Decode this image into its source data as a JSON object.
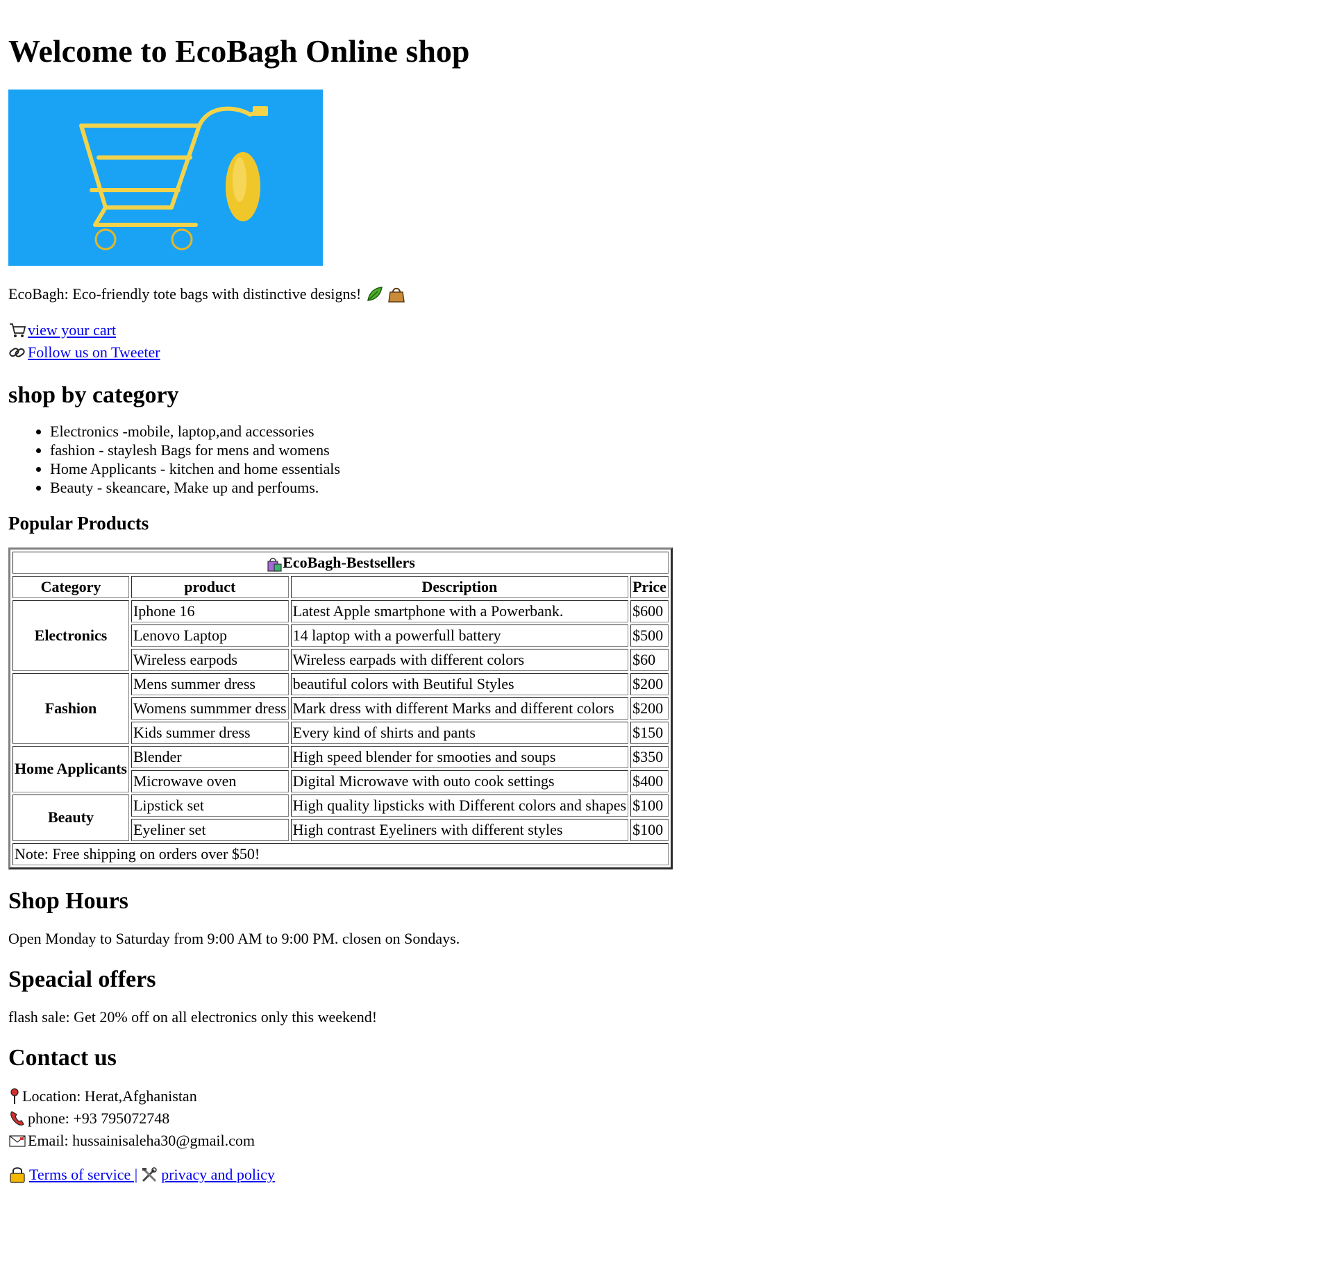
{
  "page": {
    "title": "Welcome to EcoBagh Online shop",
    "tagline": "EcoBagh: Eco-friendly tote bags with distinctive designs!"
  },
  "links": {
    "cart": " view your cart",
    "tweeter": "Follow us on Tweeter"
  },
  "categories": {
    "heading": "shop by category",
    "items": [
      "Electronics -mobile, laptop,and accessories",
      "fashion - staylesh Bags for mens and womens",
      "Home Applicants - kitchen and home essentials",
      "Beauty - skeancare, Make up and perfoums."
    ]
  },
  "products": {
    "heading": "Popular Products",
    "table_title": "EcoBagh-Bestsellers",
    "headers": [
      "Category",
      "product",
      "Description",
      "Price"
    ],
    "groups": [
      {
        "category": "Electronics",
        "rows": [
          {
            "product": "Iphone 16",
            "description": "Latest Apple smartphone with a Powerbank.",
            "price": "$600"
          },
          {
            "product": "Lenovo Laptop",
            "description": "14 laptop with a powerfull battery",
            "price": "$500"
          },
          {
            "product": "Wireless earpods",
            "description": "Wireless earpads with different colors",
            "price": "$60"
          }
        ]
      },
      {
        "category": "Fashion",
        "rows": [
          {
            "product": "Mens summer dress",
            "description": "beautiful colors with Beutiful Styles",
            "price": "$200"
          },
          {
            "product": "Womens summmer dress",
            "description": "Mark dress with different Marks and different colors",
            "price": "$200"
          },
          {
            "product": "Kids summer dress",
            "description": "Every kind of shirts and pants",
            "price": "$150"
          }
        ]
      },
      {
        "category": "Home Applicants",
        "rows": [
          {
            "product": "Blender",
            "description": "High speed blender for smooties and soups",
            "price": "$350"
          },
          {
            "product": "Microwave oven",
            "description": "Digital Microwave with outo cook settings",
            "price": "$400"
          }
        ]
      },
      {
        "category": "Beauty",
        "rows": [
          {
            "product": "Lipstick set",
            "description": "High quality lipsticks with Different colors and shapes",
            "price": "$100"
          },
          {
            "product": "Eyeliner set",
            "description": "High contrast Eyeliners with different styles",
            "price": "$100"
          }
        ]
      }
    ],
    "note": "Note: Free shipping on orders over $50!"
  },
  "hours": {
    "heading": "Shop Hours",
    "text": "Open Monday to Saturday from 9:00 AM to 9:00 PM. closen on Sondays."
  },
  "offers": {
    "heading": "Speacial offers",
    "text": "flash sale: Get 20% off on all electronics only this weekend!"
  },
  "contact": {
    "heading": "Contact us",
    "location": "Location: Herat,Afghanistan",
    "phone": "phone: +93 795072748",
    "email": "Email: hussainisaleha30@gmail.com"
  },
  "footer": {
    "terms": "Terms of service |",
    "privacy": "privacy and policy"
  },
  "colors": {
    "link": "#0000ee",
    "hero_bg": "#1aa3f5",
    "hero_cart": "#f2d34a"
  },
  "icons": [
    "leaf-icon",
    "handbag-icon",
    "cart-icon",
    "link-icon",
    "shopping-bags-icon",
    "pin-icon",
    "phone-icon",
    "envelope-icon",
    "lock-icon",
    "tools-icon"
  ]
}
